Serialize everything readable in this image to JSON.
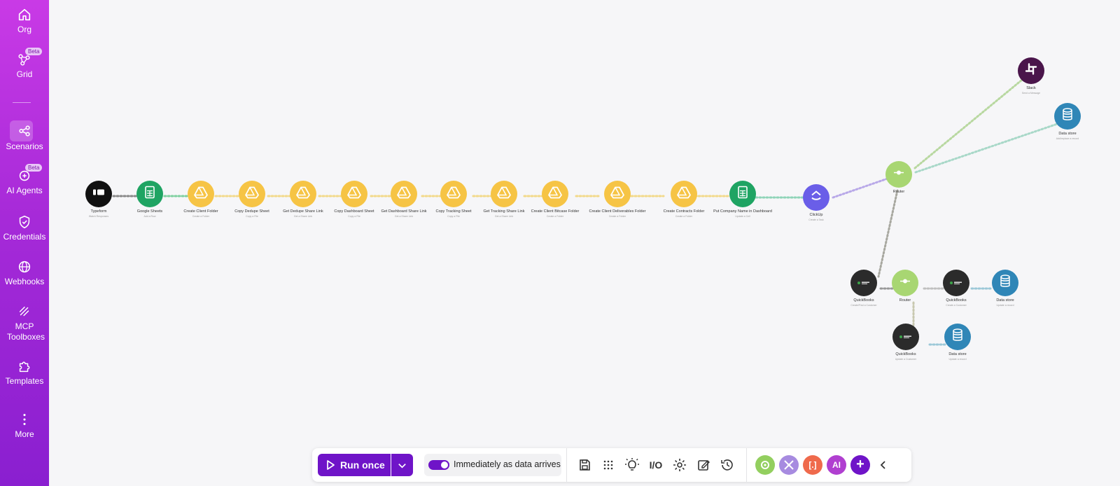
{
  "sidebar": {
    "items": [
      {
        "label": "Org",
        "icon": "home-icon"
      },
      {
        "label": "Grid",
        "icon": "grid-network-icon",
        "badge": "Beta"
      },
      {
        "label": "Scenarios",
        "icon": "share-nodes-icon",
        "active": true
      },
      {
        "label": "AI Agents",
        "icon": "ai-agent-icon",
        "badge": "Beta"
      },
      {
        "label": "Credentials",
        "icon": "shield-check-icon"
      },
      {
        "label": "Webhooks",
        "icon": "globe-icon"
      },
      {
        "label": "MCP Toolboxes",
        "icon": "mcp-icon"
      },
      {
        "label": "Templates",
        "icon": "puzzle-icon"
      },
      {
        "label": "More",
        "icon": "more-vertical-icon"
      }
    ]
  },
  "scenario": {
    "nodes": [
      {
        "label": "Typeform",
        "sub": "Watch Responses",
        "color": "#111111",
        "icon": "typeform-icon"
      },
      {
        "label": "Google Sheets",
        "sub": "Add a Row",
        "color": "#1fa463",
        "icon": "google-sheets-icon"
      },
      {
        "label": "Create Client Folder",
        "sub": "Create a Folder",
        "color": "#f6c445",
        "icon": "google-drive-icon"
      },
      {
        "label": "Copy Dedupe Sheet",
        "sub": "Copy a File",
        "color": "#f6c445",
        "icon": "google-drive-icon"
      },
      {
        "label": "Get Dedupe Share Link",
        "sub": "Get a Share Link",
        "color": "#f6c445",
        "icon": "google-drive-icon"
      },
      {
        "label": "Copy Dashboard Sheet",
        "sub": "Copy a File",
        "color": "#f6c445",
        "icon": "google-drive-icon"
      },
      {
        "label": "Get Dashboard Share Link",
        "sub": "Get a Share Link",
        "color": "#f6c445",
        "icon": "google-drive-icon"
      },
      {
        "label": "Copy Tracking Sheet",
        "sub": "Copy a File",
        "color": "#f6c445",
        "icon": "google-drive-icon"
      },
      {
        "label": "Get Tracking Share Link",
        "sub": "Get a Share Link",
        "color": "#f6c445",
        "icon": "google-drive-icon"
      },
      {
        "label": "Create Client Bitcase Folder",
        "sub": "Create a Folder",
        "color": "#f6c445",
        "icon": "google-drive-icon"
      },
      {
        "label": "Create Client Deliverables Folder",
        "sub": "Create a Folder",
        "color": "#f6c445",
        "icon": "google-drive-icon"
      },
      {
        "label": "Create Contracts Folder",
        "sub": "Create a Folder",
        "color": "#f6c445",
        "icon": "google-drive-icon"
      },
      {
        "label": "Put Company Name in Dashboard",
        "sub": "Update a Cell",
        "color": "#1fa463",
        "icon": "google-sheets-icon"
      },
      {
        "label": "ClickUp",
        "sub": "Create a Task",
        "color": "#6a5ee8",
        "icon": "clickup-icon"
      },
      {
        "label": "Router",
        "sub": "",
        "color": "#a8d672",
        "icon": "router-icon"
      },
      {
        "label": "Slack",
        "sub": "Send a Message",
        "color": "#4a154b",
        "icon": "slack-icon"
      },
      {
        "label": "Data store",
        "sub": "Add/replace a record",
        "color": "#2f86b7",
        "icon": "datastore-icon"
      },
      {
        "label": "QuickBooks",
        "sub": "Create/Find a Customer",
        "color": "#2b2b2b",
        "icon": "quickbooks-icon"
      },
      {
        "label": "Router",
        "sub": "",
        "color": "#a8d672",
        "icon": "router-icon"
      },
      {
        "label": "QuickBooks",
        "sub": "Create a Customer",
        "color": "#2b2b2b",
        "icon": "quickbooks-icon"
      },
      {
        "label": "Data store",
        "sub": "Update a record",
        "color": "#2f86b7",
        "icon": "datastore-icon"
      },
      {
        "label": "QuickBooks",
        "sub": "Update a Customer",
        "color": "#2b2b2b",
        "icon": "quickbooks-icon"
      },
      {
        "label": "Data store",
        "sub": "Update a record",
        "color": "#2f86b7",
        "icon": "datastore-icon"
      }
    ]
  },
  "toolbar": {
    "run_label": "Run once",
    "schedule_label": "Immediately as data arrives",
    "schedule_on": true,
    "tools": [
      "save-icon",
      "dots-grid-icon",
      "bulb-icon",
      "io-icon",
      "gear-icon",
      "notes-icon",
      "history-icon"
    ],
    "io_text": "I/O",
    "circles": [
      {
        "icon": "tools-icon",
        "color": "#93cf5f",
        "text": ""
      },
      {
        "icon": "flow-control-icon",
        "color": "#a78be0",
        "text": ""
      },
      {
        "icon": "text-parser-icon",
        "color": "#ef6a4c",
        "text": "[.]"
      },
      {
        "icon": "ai-icon",
        "color": "#b03fd0",
        "text": "AI"
      },
      {
        "icon": "add-icon",
        "color": "#6f14c8",
        "text": "+"
      }
    ]
  }
}
